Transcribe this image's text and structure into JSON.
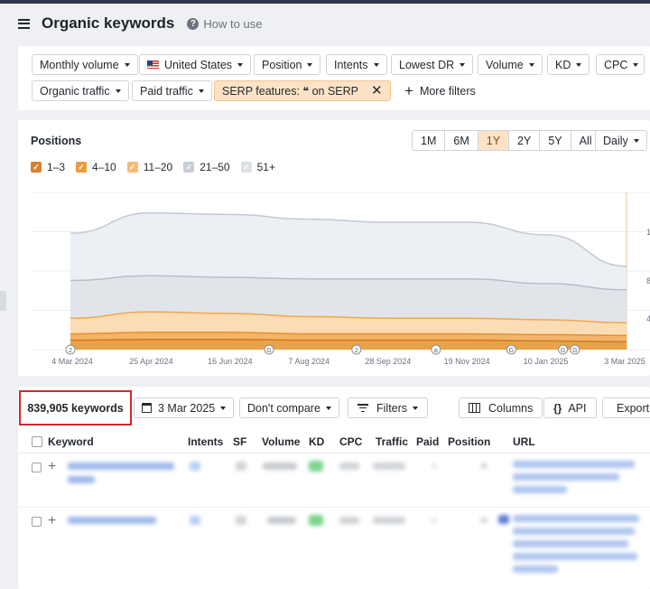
{
  "header": {
    "title": "Organic keywords",
    "how_to_use": "How to use"
  },
  "filters": {
    "row1": [
      "Monthly volume",
      "United States",
      "Position",
      "Intents",
      "Lowest DR",
      "Volume",
      "KD",
      "CPC"
    ],
    "organic_traffic": "Organic traffic",
    "paid_traffic": "Paid traffic",
    "serp_features": "SERP features: ❝ on SERP",
    "more_filters": "More filters"
  },
  "positions": {
    "title": "Positions",
    "ranges": [
      "1M",
      "6M",
      "1Y",
      "2Y",
      "5Y",
      "All"
    ],
    "active_range": "1Y",
    "interval": "Daily",
    "legend": [
      {
        "label": "1–3",
        "color": "#d9822b",
        "checked": true
      },
      {
        "label": "4–10",
        "color": "#ef9a3c",
        "checked": true
      },
      {
        "label": "11–20",
        "color": "#f6bb72",
        "checked": true
      },
      {
        "label": "21–50",
        "color": "#c8ced6",
        "checked": true
      },
      {
        "label": "51+",
        "color": "#dde2e8",
        "checked": true
      }
    ]
  },
  "chart_data": {
    "type": "area",
    "x": [
      "4 Mar 2024",
      "25 Apr 2024",
      "16 Jun 2024",
      "7 Aug 2024",
      "28 Sep 2024",
      "19 Nov 2024",
      "10 Jan 2025",
      "3 Mar 2025"
    ],
    "x_ticks": [
      "4 Mar 2024",
      "25 Apr 2024",
      "16 Jun 2024",
      "7 Aug 2024",
      "28 Sep 2024",
      "19 Nov 2024",
      "10 Jan 2025",
      "3 Mar 2025"
    ],
    "y_ticks_right": [
      "1",
      "8",
      "4"
    ],
    "series": [
      {
        "name": "1–3",
        "values": [
          0.06,
          0.065,
          0.065,
          0.06,
          0.06,
          0.06,
          0.055,
          0.05
        ]
      },
      {
        "name": "4–10",
        "values": [
          0.1,
          0.11,
          0.11,
          0.1,
          0.1,
          0.1,
          0.095,
          0.09
        ]
      },
      {
        "name": "11–20",
        "values": [
          0.2,
          0.24,
          0.23,
          0.21,
          0.2,
          0.2,
          0.19,
          0.17
        ]
      },
      {
        "name": "21–50",
        "values": [
          0.44,
          0.47,
          0.46,
          0.45,
          0.45,
          0.45,
          0.42,
          0.38
        ]
      },
      {
        "name": "51+",
        "values": [
          0.74,
          0.87,
          0.86,
          0.83,
          0.81,
          0.81,
          0.73,
          0.53
        ]
      }
    ],
    "annotations": [
      "2",
      "G",
      "2",
      "a",
      "G",
      "G",
      "G"
    ],
    "grid": true
  },
  "table": {
    "keyword_count": "839,905 keywords",
    "date": "3 Mar 2025",
    "compare": "Don't compare",
    "filters": "Filters",
    "columns": "Columns",
    "api": "API",
    "export": "Export",
    "headers": [
      "Keyword",
      "Intents",
      "SF",
      "Volume",
      "KD",
      "CPC",
      "Traffic",
      "Paid",
      "Position",
      "URL"
    ]
  }
}
